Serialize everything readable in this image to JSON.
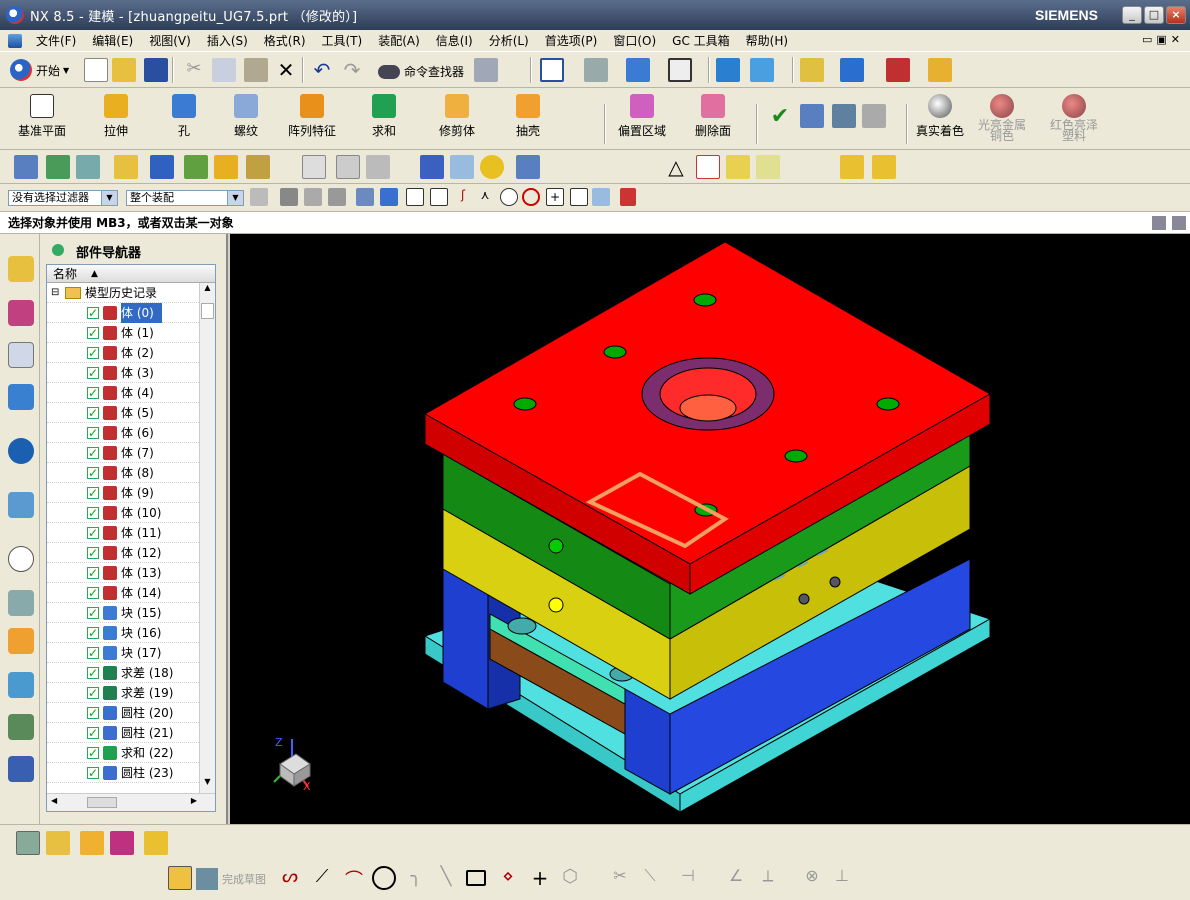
{
  "window": {
    "title": "NX 8.5 - 建模 - [zhuangpeitu_UG7.5.prt （修改的）]",
    "brand": "SIEMENS"
  },
  "menu": {
    "items": [
      "文件(F)",
      "编辑(E)",
      "视图(V)",
      "插入(S)",
      "格式(R)",
      "工具(T)",
      "装配(A)",
      "信息(I)",
      "分析(L)",
      "首选项(P)",
      "窗口(O)",
      "GC 工具箱",
      "帮助(H)"
    ]
  },
  "toolbar1": {
    "start_label": "开始",
    "command_finder": "命令查找器"
  },
  "toolbar2": {
    "labels": [
      "基准平面",
      "拉伸",
      "孔",
      "螺纹",
      "阵列特征",
      "求和",
      "修剪体",
      "抽壳",
      "偏置区域",
      "删除面",
      "真实着色",
      "光亮金属铜色",
      "红色亮泽塑料"
    ]
  },
  "filters": {
    "type_filter": "没有选择过滤器",
    "scope": "整个装配"
  },
  "status": {
    "message": "选择对象并使用 MB3，或者双击某一对象"
  },
  "navigator": {
    "title": "部件导航器",
    "column": "名称",
    "root": "模型历史记录",
    "items": [
      {
        "label": "体 (0)",
        "icon": "body-icon"
      },
      {
        "label": "体 (1)",
        "icon": "body-icon"
      },
      {
        "label": "体 (2)",
        "icon": "body-icon"
      },
      {
        "label": "体 (3)",
        "icon": "body-icon"
      },
      {
        "label": "体 (4)",
        "icon": "body-icon"
      },
      {
        "label": "体 (5)",
        "icon": "body-icon"
      },
      {
        "label": "体 (6)",
        "icon": "body-icon"
      },
      {
        "label": "体 (7)",
        "icon": "body-icon"
      },
      {
        "label": "体 (8)",
        "icon": "body-icon"
      },
      {
        "label": "体 (9)",
        "icon": "body-icon"
      },
      {
        "label": "体 (10)",
        "icon": "body-icon"
      },
      {
        "label": "体 (11)",
        "icon": "body-icon"
      },
      {
        "label": "体 (12)",
        "icon": "body-icon"
      },
      {
        "label": "体 (13)",
        "icon": "body-icon"
      },
      {
        "label": "体 (14)",
        "icon": "body-icon"
      },
      {
        "label": "块 (15)",
        "icon": "block-icon"
      },
      {
        "label": "块 (16)",
        "icon": "block-icon"
      },
      {
        "label": "块 (17)",
        "icon": "block-icon"
      },
      {
        "label": "求差 (18)",
        "icon": "subtract-icon"
      },
      {
        "label": "求差 (19)",
        "icon": "subtract-icon"
      },
      {
        "label": "圆柱 (20)",
        "icon": "cylinder-icon"
      },
      {
        "label": "圆柱 (21)",
        "icon": "cylinder-icon"
      },
      {
        "label": "求和 (22)",
        "icon": "unite-icon"
      },
      {
        "label": "圆柱 (23)",
        "icon": "cylinder-icon"
      }
    ]
  },
  "sketch_bar": {
    "finish_sketch": "完成草图"
  },
  "colors": {
    "top_plate": "#ff0000",
    "a_plate": "#148a14",
    "b_plate": "#d8d010",
    "support": "#1f3fd0",
    "base": "#50e0e0",
    "accent": "#7b2d6e"
  }
}
